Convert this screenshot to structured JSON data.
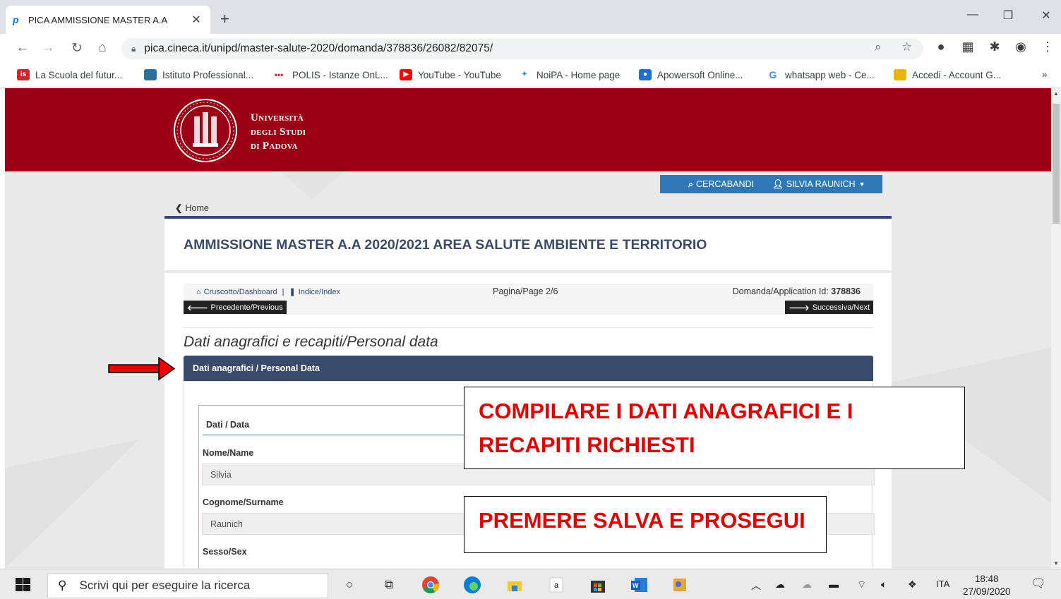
{
  "browser": {
    "tab_title": "PICA AMMISSIONE MASTER A.A",
    "tab_favicon": "p",
    "new_tab": "+",
    "url": "pica.cineca.it/unipd/master-salute-2020/domanda/378836/26082/82075/",
    "bookmarks": [
      {
        "label": "La Scuola del futur...",
        "icon": "is",
        "color": "#d2222d"
      },
      {
        "label": "Istituto Professional...",
        "icon": "",
        "color": "#2d6f9b"
      },
      {
        "label": "POLIS - Istanze OnL...",
        "icon": "•••",
        "color": "#ffffff"
      },
      {
        "label": "YouTube - YouTube",
        "icon": "▶",
        "color": "#ff0000"
      },
      {
        "label": "NoiPA - Home page",
        "icon": "",
        "color": "#ffffff"
      },
      {
        "label": "Apowersoft Online...",
        "icon": "",
        "color": "#1f6fcc"
      },
      {
        "label": "whatsapp web - Ce...",
        "icon": "G",
        "color": "#ffffff"
      },
      {
        "label": "Accedi - Account G...",
        "icon": "",
        "color": "#e8b500"
      }
    ],
    "bookmarks_more": "»"
  },
  "site": {
    "university_lines": [
      "Università",
      "degli Studi",
      "di Padova"
    ],
    "nav": {
      "search": "CERCABANDI",
      "user": "SILVIA RAUNICH"
    },
    "home_link": "Home",
    "title": "AMMISSIONE MASTER A.A 2020/2021 AREA SALUTE AMBIENTE E TERRITORIO",
    "dashboard": "Cruscotto/Dashboard",
    "crumb_sep": "|",
    "index": "Indice/Index",
    "page_info": "Pagina/Page 2/6",
    "application_label": "Domanda/Application Id:",
    "application_id": "378836",
    "prev": "Precedente/Previous",
    "next": "Successiva/Next",
    "section_title": "Dati anagrafici e recapiti/Personal data",
    "panel_title": "Dati anagrafici / Personal Data",
    "fieldset_legend": "Dati / Data",
    "fields": [
      {
        "label": "Nome/Name",
        "value": "Silvia"
      },
      {
        "label": "Cognome/Surname",
        "value": "Raunich"
      },
      {
        "label": "Sesso/Sex",
        "value": ""
      }
    ]
  },
  "annotations": {
    "callout1_line1": "COMPILARE I DATI ANAGRAFICI E I",
    "callout1_line2": "RECAPITI RICHIESTI",
    "callout2": "PREMERE SALVA E PROSEGUI",
    "arrow_color": "#ee0000",
    "text_color": "#e00000"
  },
  "taskbar": {
    "search_placeholder": "Scrivi qui per eseguire la ricerca",
    "language": "ITA",
    "time": "18:48",
    "date": "27/09/2020"
  }
}
